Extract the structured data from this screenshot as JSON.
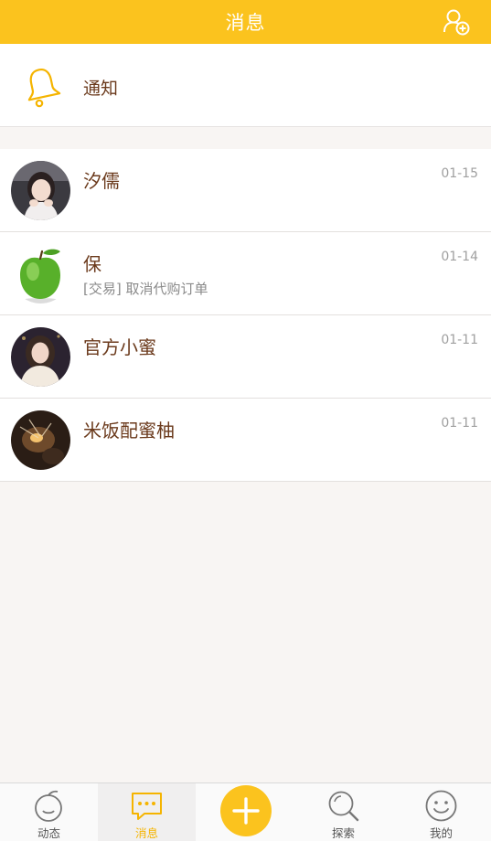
{
  "header": {
    "title": "消息",
    "add_contact_icon": "add-user-icon"
  },
  "notice": {
    "label": "通知",
    "icon": "bell-icon"
  },
  "chats": [
    {
      "name": "汐儒",
      "time": "01-15",
      "preview": ""
    },
    {
      "name": "保",
      "time": "01-14",
      "preview": "[交易] 取消代购订单"
    },
    {
      "name": "官方小蜜",
      "time": "01-11",
      "preview": ""
    },
    {
      "name": "米饭配蜜柚",
      "time": "01-11",
      "preview": ""
    }
  ],
  "tabbar": {
    "tabs": [
      {
        "label": "动态",
        "icon": "moments-icon",
        "active": false
      },
      {
        "label": "消息",
        "icon": "chat-icon",
        "active": true
      },
      {
        "label": "探索",
        "icon": "search-icon",
        "active": false
      },
      {
        "label": "我的",
        "icon": "smiley-icon",
        "active": false
      }
    ],
    "center_button_icon": "plus-icon"
  },
  "colors": {
    "accent": "#fbc31e",
    "name_text": "#6b3a1c",
    "active_tab": "#f5b400"
  }
}
